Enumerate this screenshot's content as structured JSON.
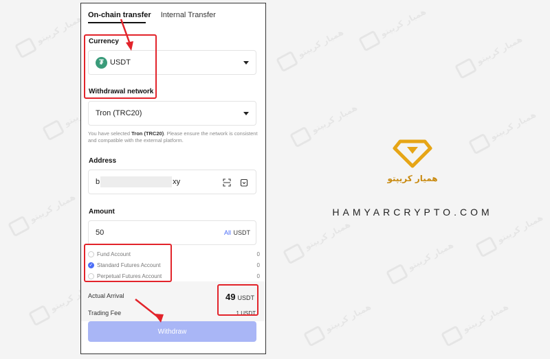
{
  "tabs": [
    {
      "label": "On-chain transfer",
      "active": true
    },
    {
      "label": "Internal Transfer",
      "active": false
    }
  ],
  "currency": {
    "label": "Currency",
    "value": "USDT",
    "icon": "tether-logo-icon"
  },
  "network": {
    "label": "Withdrawal network",
    "value": "Tron (TRC20)",
    "note_prefix": "You have selected ",
    "note_bold": "Tron (TRC20)",
    "note_suffix": ". Please ensure the network is consistent and compatible with the external platform."
  },
  "address": {
    "label": "Address",
    "value_start": "b",
    "value_end": "xy"
  },
  "amount": {
    "label": "Amount",
    "value": "50",
    "all": "All",
    "unit": "USDT"
  },
  "accounts": [
    {
      "name": "Fund Account",
      "balance": "0",
      "checked": false
    },
    {
      "name": "Standard Futures Account",
      "balance": "0",
      "checked": true
    },
    {
      "name": "Perpetual Futures Account",
      "balance": "0",
      "checked": false
    }
  ],
  "summary": {
    "arrival_label": "Actual Arrival",
    "arrival_value": "49",
    "arrival_unit": "USDT",
    "fee_label": "Trading Fee",
    "fee_value": "1 USDT"
  },
  "withdraw_label": "Withdraw",
  "brand": {
    "sub": "همیار کریپتو",
    "name": "HAMYARCRYPTO.COM"
  },
  "watermark_text": "همیار کریپتو",
  "colors": {
    "highlight": "#e2232a",
    "accent": "#4a6cf7",
    "button": "#a9b6f6",
    "brand": "#c98b12",
    "tether": "#3a9b7a"
  }
}
